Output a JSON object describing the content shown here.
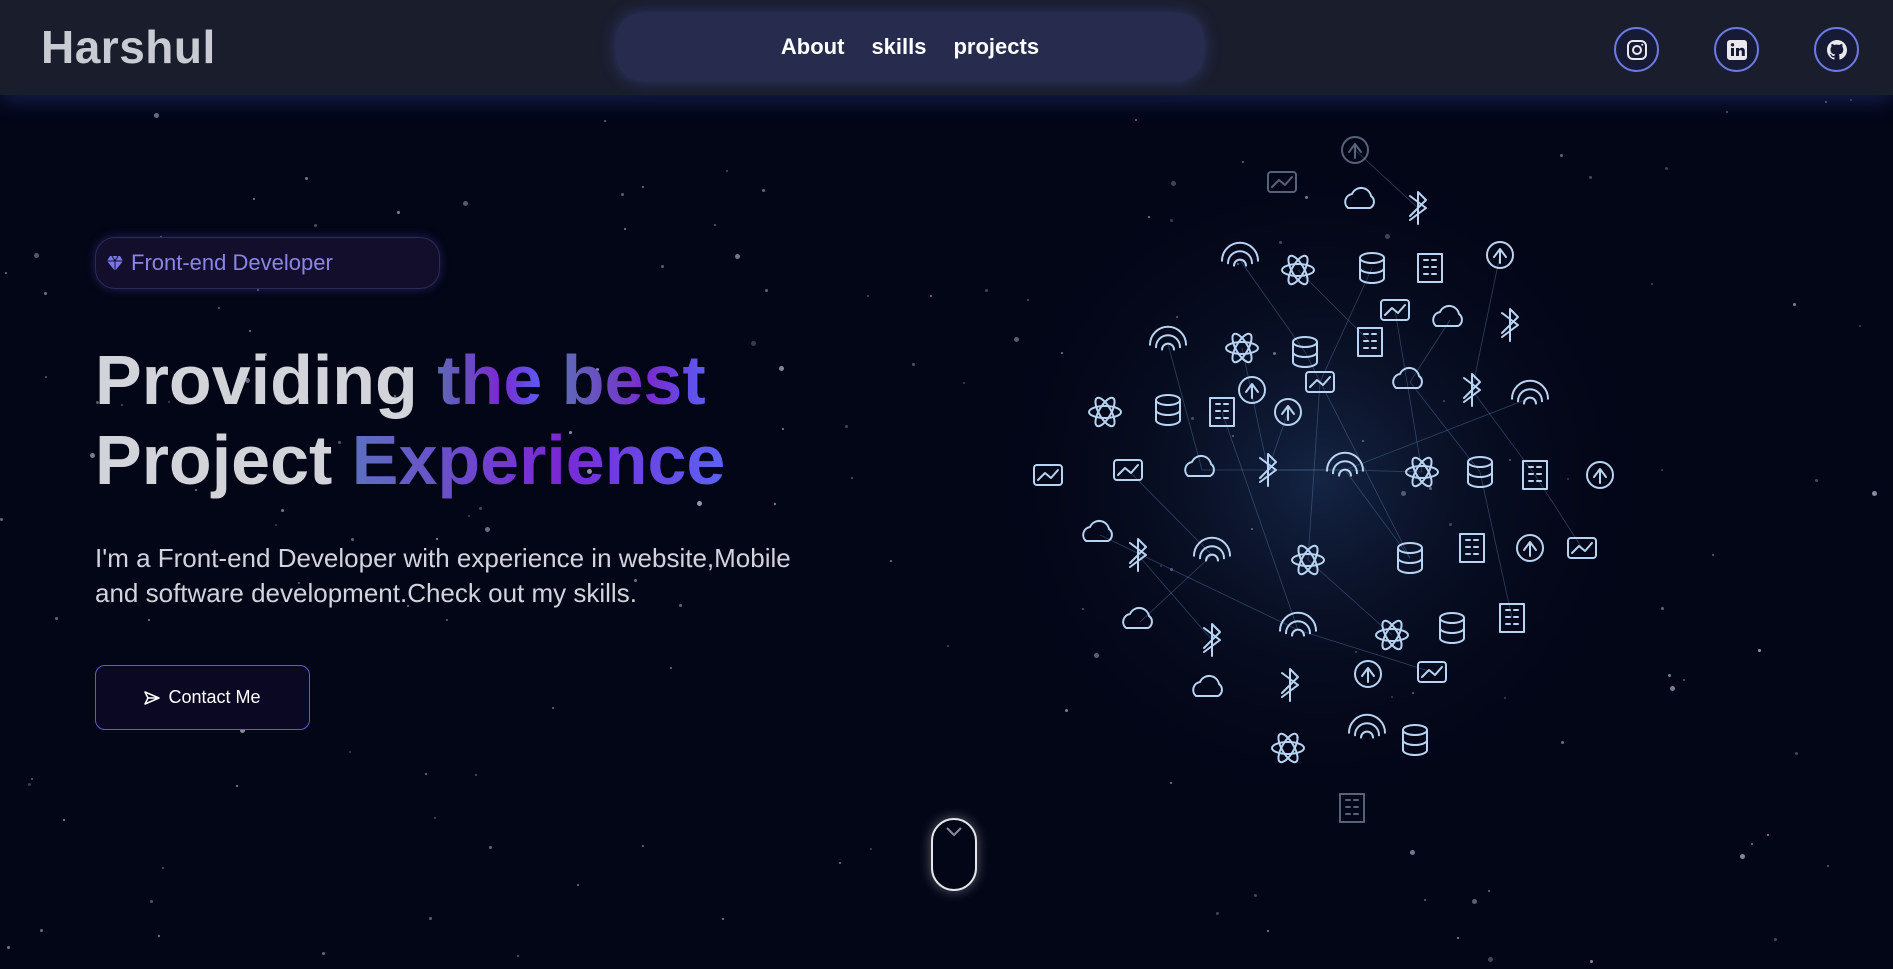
{
  "navbar": {
    "brand": "Harshul",
    "links": [
      "About",
      "skills",
      "projects"
    ],
    "social": [
      "instagram-icon",
      "linkedin-icon",
      "github-icon"
    ]
  },
  "hero": {
    "badge_icon": "gem-icon",
    "badge": "Front-end Developer",
    "headline": {
      "line1_plain": "Providing",
      "line1_grad_a": "the",
      "line1_grad_b": "best",
      "line2_plain": "Project",
      "line2_grad": "Experience"
    },
    "description_1": "I'm a Front-end Developer with experience in website,Mobile",
    "description_2": "and software development.Check out my skills.",
    "contact_icon": "send-icon",
    "contact_label": "Contact Me"
  },
  "scroll_indicator": "mouse-scroll-icon",
  "colors": {
    "background": "#030617",
    "navbar": "#1a1d2c",
    "nav_pill": "#272b4d",
    "accent_purple": "#7a2ad0",
    "accent_blue": "#5b5cf2",
    "badge_text": "#8b86e6",
    "globe_icons": "#b8d4f2"
  }
}
